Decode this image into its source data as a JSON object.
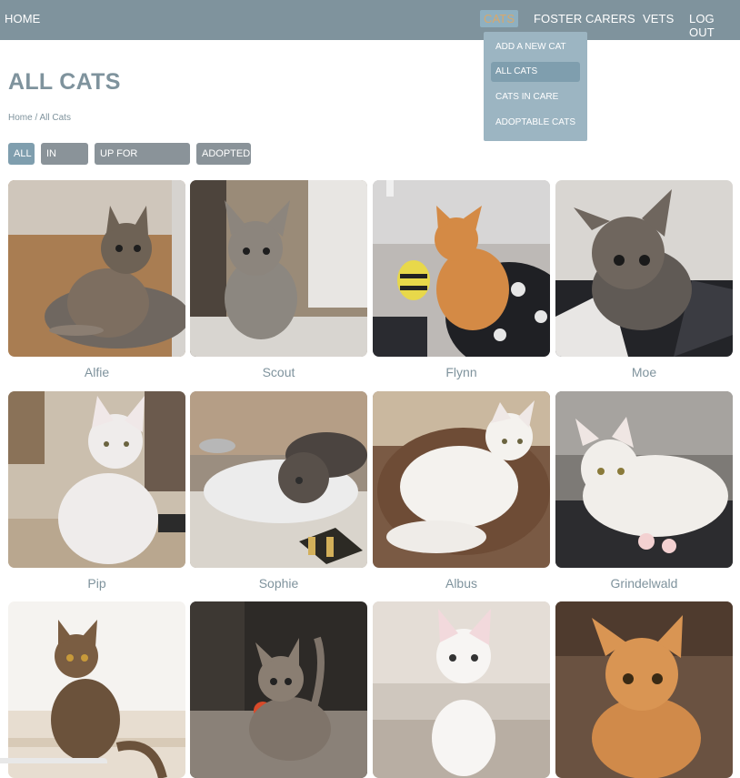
{
  "nav": {
    "home": "HOME",
    "cats": "CATS",
    "foster_carers": "FOSTER CARERS",
    "vets": "VETS",
    "log_out": "LOG OUT"
  },
  "dropdown": {
    "items": [
      {
        "label": "ADD A NEW CAT",
        "active": false
      },
      {
        "label": "ALL CATS",
        "active": true
      },
      {
        "label": "CATS IN CARE",
        "active": false
      },
      {
        "label": "ADOPTABLE CATS",
        "active": false
      }
    ]
  },
  "page": {
    "title": "ALL CATS",
    "breadcrumb": {
      "home": "Home",
      "separator": "/",
      "current": "All Cats"
    }
  },
  "filters": [
    {
      "label": "ALL",
      "active": true
    },
    {
      "label": "IN CARE",
      "active": false
    },
    {
      "label": "UP FOR ADOPTION",
      "active": false
    },
    {
      "label": "ADOPTED",
      "active": false
    }
  ],
  "cats": [
    {
      "name": "Alfie"
    },
    {
      "name": "Scout"
    },
    {
      "name": "Flynn"
    },
    {
      "name": "Moe"
    },
    {
      "name": "Pip"
    },
    {
      "name": "Sophie"
    },
    {
      "name": "Albus"
    },
    {
      "name": "Grindelwald"
    },
    {
      "name": ""
    },
    {
      "name": ""
    },
    {
      "name": ""
    },
    {
      "name": ""
    }
  ],
  "colors": {
    "navbar": "#7f939d",
    "accent": "#7f9eae",
    "dropdown": "#9cb5c2",
    "active_nav_text": "#d9a86a",
    "filter_inactive": "#8a9399"
  }
}
